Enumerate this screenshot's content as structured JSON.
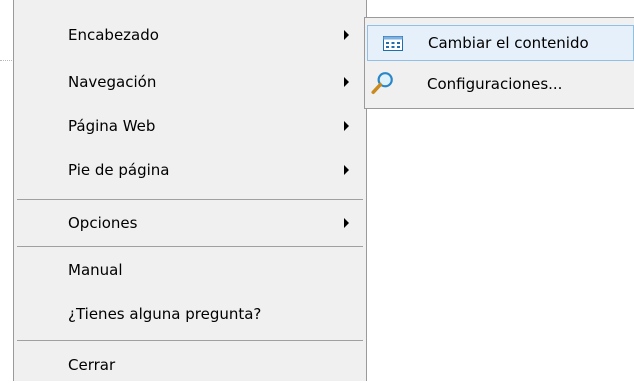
{
  "menu": {
    "items": [
      {
        "label": "Encabezado",
        "has_submenu": true
      },
      {
        "label": "Navegación",
        "has_submenu": true
      },
      {
        "label": "Página Web",
        "has_submenu": true
      },
      {
        "label": "Pie de página",
        "has_submenu": true
      },
      {
        "label": "Opciones",
        "has_submenu": true
      },
      {
        "label": "Manual",
        "has_submenu": false
      },
      {
        "label": "¿Tienes alguna pregunta?",
        "has_submenu": false
      },
      {
        "label": "Cerrar",
        "has_submenu": false
      }
    ]
  },
  "submenu": {
    "parent": "Encabezado",
    "items": [
      {
        "label": "Cambiar el contenido",
        "icon": "edit-content-icon",
        "highlighted": true
      },
      {
        "label": "Configuraciones...",
        "icon": "magnifier-icon",
        "highlighted": false
      }
    ]
  },
  "colors": {
    "menu_bg": "#f0f0f0",
    "border": "#9a9a9a",
    "highlight_bg": "#e5f0fb",
    "highlight_border": "#90c0e8"
  }
}
